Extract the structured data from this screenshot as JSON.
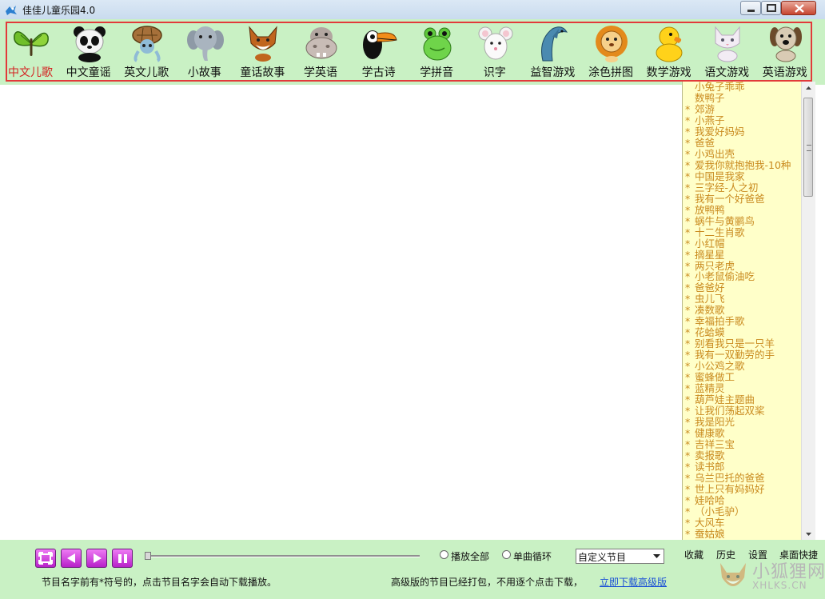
{
  "window": {
    "title": "佳佳儿童乐园4.0"
  },
  "toolbar": {
    "items": [
      {
        "label": "中文儿歌",
        "icon": "butterfly-icon",
        "active": true
      },
      {
        "label": "中文童谣",
        "icon": "panda-icon"
      },
      {
        "label": "英文儿歌",
        "icon": "turtle-icon"
      },
      {
        "label": "小故事",
        "icon": "elephant-icon"
      },
      {
        "label": "童话故事",
        "icon": "fox-icon"
      },
      {
        "label": "学英语",
        "icon": "hippo-icon"
      },
      {
        "label": "学古诗",
        "icon": "toucan-icon"
      },
      {
        "label": "学拼音",
        "icon": "frog-icon"
      },
      {
        "label": "识字",
        "icon": "mouse-icon"
      },
      {
        "label": "益智游戏",
        "icon": "dolphin-icon"
      },
      {
        "label": "涂色拼图",
        "icon": "lion-icon"
      },
      {
        "label": "数学游戏",
        "icon": "duck-icon"
      },
      {
        "label": "语文游戏",
        "icon": "cat-icon"
      },
      {
        "label": "英语游戏",
        "icon": "dog-icon"
      }
    ]
  },
  "songs": [
    {
      "title": "小兔子乖乖",
      "starred": false
    },
    {
      "title": "数鸭子",
      "starred": false
    },
    {
      "title": "郊游",
      "starred": true
    },
    {
      "title": "小燕子",
      "starred": true
    },
    {
      "title": "我爱好妈妈",
      "starred": true
    },
    {
      "title": "爸爸",
      "starred": true
    },
    {
      "title": "小鸡出壳",
      "starred": true
    },
    {
      "title": "爱我你就抱抱我-10种",
      "starred": true
    },
    {
      "title": "中国是我家",
      "starred": true
    },
    {
      "title": "三字经-人之初",
      "starred": true
    },
    {
      "title": "我有一个好爸爸",
      "starred": true
    },
    {
      "title": "放鸭鸭",
      "starred": true
    },
    {
      "title": "蜗牛与黄鹂鸟",
      "starred": true
    },
    {
      "title": "十二生肖歌",
      "starred": true
    },
    {
      "title": "小红帽",
      "starred": true
    },
    {
      "title": "摘星星",
      "starred": true
    },
    {
      "title": "两只老虎",
      "starred": true
    },
    {
      "title": "小老鼠偷油吃",
      "starred": true
    },
    {
      "title": "爸爸好",
      "starred": true
    },
    {
      "title": "虫儿飞",
      "starred": true
    },
    {
      "title": "凑数歌",
      "starred": true
    },
    {
      "title": "幸福拍手歌",
      "starred": true
    },
    {
      "title": "花蛤蟆",
      "starred": true
    },
    {
      "title": "别看我只是一只羊",
      "starred": true
    },
    {
      "title": "我有一双勤劳的手",
      "starred": true
    },
    {
      "title": "小公鸡之歌",
      "starred": true
    },
    {
      "title": "蜜蜂做工",
      "starred": true
    },
    {
      "title": "蓝精灵",
      "starred": true
    },
    {
      "title": "葫芦娃主题曲",
      "starred": true
    },
    {
      "title": "让我们荡起双桨",
      "starred": true
    },
    {
      "title": "我是阳光",
      "starred": true
    },
    {
      "title": "健康歌",
      "starred": true
    },
    {
      "title": "吉祥三宝",
      "starred": true
    },
    {
      "title": "卖报歌",
      "starred": true
    },
    {
      "title": "读书郎",
      "starred": true
    },
    {
      "title": "乌兰巴托的爸爸",
      "starred": true
    },
    {
      "title": "世上只有妈妈好",
      "starred": true
    },
    {
      "title": "娃哈哈",
      "starred": true
    },
    {
      "title": "（小毛驴）",
      "starred": true
    },
    {
      "title": "大风车",
      "starred": true
    },
    {
      "title": "蚕姑娘",
      "starred": true
    }
  ],
  "player": {
    "progress": 0,
    "play_all_label": "播放全部",
    "single_loop_label": "单曲循环",
    "program_select_value": "自定义节目"
  },
  "bottom_links": {
    "favorites": "收藏",
    "history": "历史",
    "settings": "设置",
    "desktop_shortcut": "桌面快捷"
  },
  "hints": {
    "left": "节目名字前有*符号的，点击节目名字会自动下载播放。",
    "right": "高级版的节目已经打包，不用逐个点击下载，",
    "download_link": "立即下载高级版"
  },
  "watermark": {
    "name": "小狐狸网",
    "domain": "XHLKS.CN"
  },
  "colors": {
    "toolbar_bg": "#c9f1c4",
    "song_text": "#c98a1e",
    "panel_bg": "#ffffc9",
    "active_label": "#d42323",
    "highlight_frame": "#e23a3a",
    "control_button": "#c63cd6"
  }
}
